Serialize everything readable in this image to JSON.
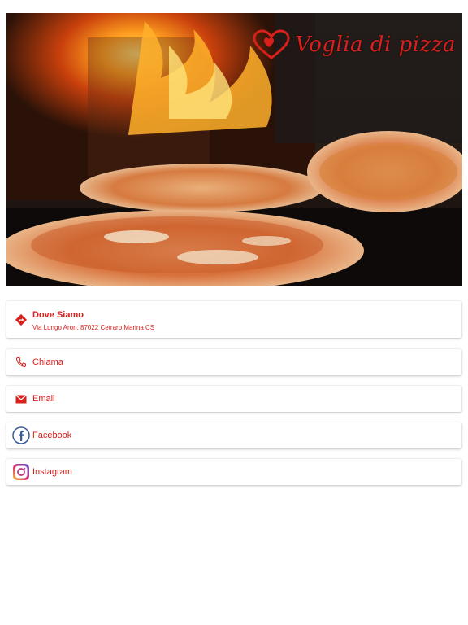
{
  "hero": {
    "logo_text": "Voglia di pizza",
    "image": "wood-fired-pizza-photo"
  },
  "contacts": {
    "address": {
      "title": "Dove Siamo",
      "subtitle": "Via Lungo Aron, 87022 Cetraro Marina CS",
      "icon": "directions-icon"
    },
    "call": {
      "label": "Chiama",
      "icon": "phone-icon"
    },
    "email": {
      "label": "Email",
      "icon": "mail-icon"
    },
    "facebook": {
      "label": "Facebook",
      "icon": "facebook-icon"
    },
    "instagram": {
      "label": "Instagram",
      "icon": "instagram-icon"
    }
  },
  "colors": {
    "accent": "#d8201c",
    "background": "#ffffff",
    "facebook_blue": "#3b5998"
  }
}
